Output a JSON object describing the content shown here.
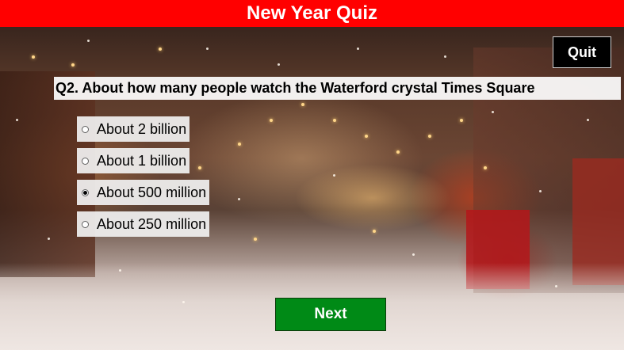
{
  "header": {
    "title": "New Year Quiz",
    "accent_color": "#ff0000"
  },
  "toolbar": {
    "quit_label": "Quit"
  },
  "question": {
    "text": "Q2. About how many people watch the Waterford crystal Times Square"
  },
  "options": [
    {
      "label": "About 2 billion",
      "selected": false
    },
    {
      "label": "About 1 billion",
      "selected": false
    },
    {
      "label": "About 500 million",
      "selected": true
    },
    {
      "label": "About 250 million",
      "selected": false
    }
  ],
  "footer": {
    "next_label": "Next",
    "next_color": "#008a16"
  },
  "background": {
    "icon": "snowy-night-street-image"
  }
}
